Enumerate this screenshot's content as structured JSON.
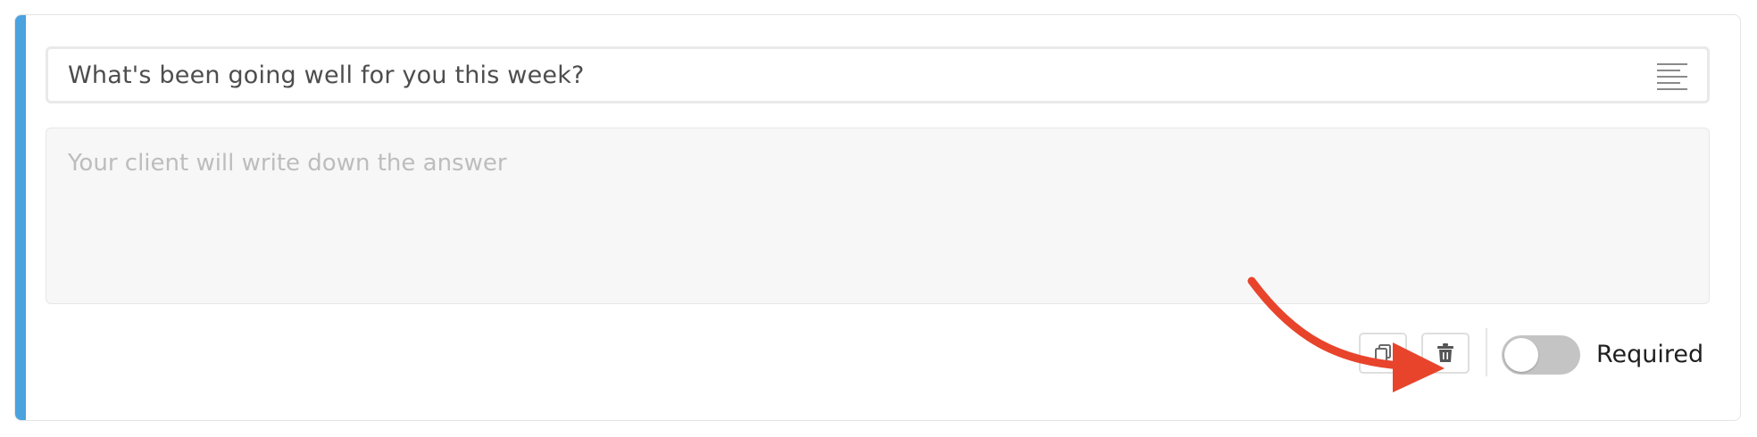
{
  "question": {
    "text": "What's been going well for you this week?",
    "type_icon": "text-align-icon"
  },
  "answer": {
    "placeholder": "Your client will write down the answer"
  },
  "footer": {
    "copy_icon": "copy-icon",
    "delete_icon": "trash-icon",
    "required_label": "Required",
    "required_enabled": false
  },
  "colors": {
    "accent": "#4aa3df",
    "annotation_arrow": "#e8442c",
    "toggle_off": "#c4c4c4"
  }
}
